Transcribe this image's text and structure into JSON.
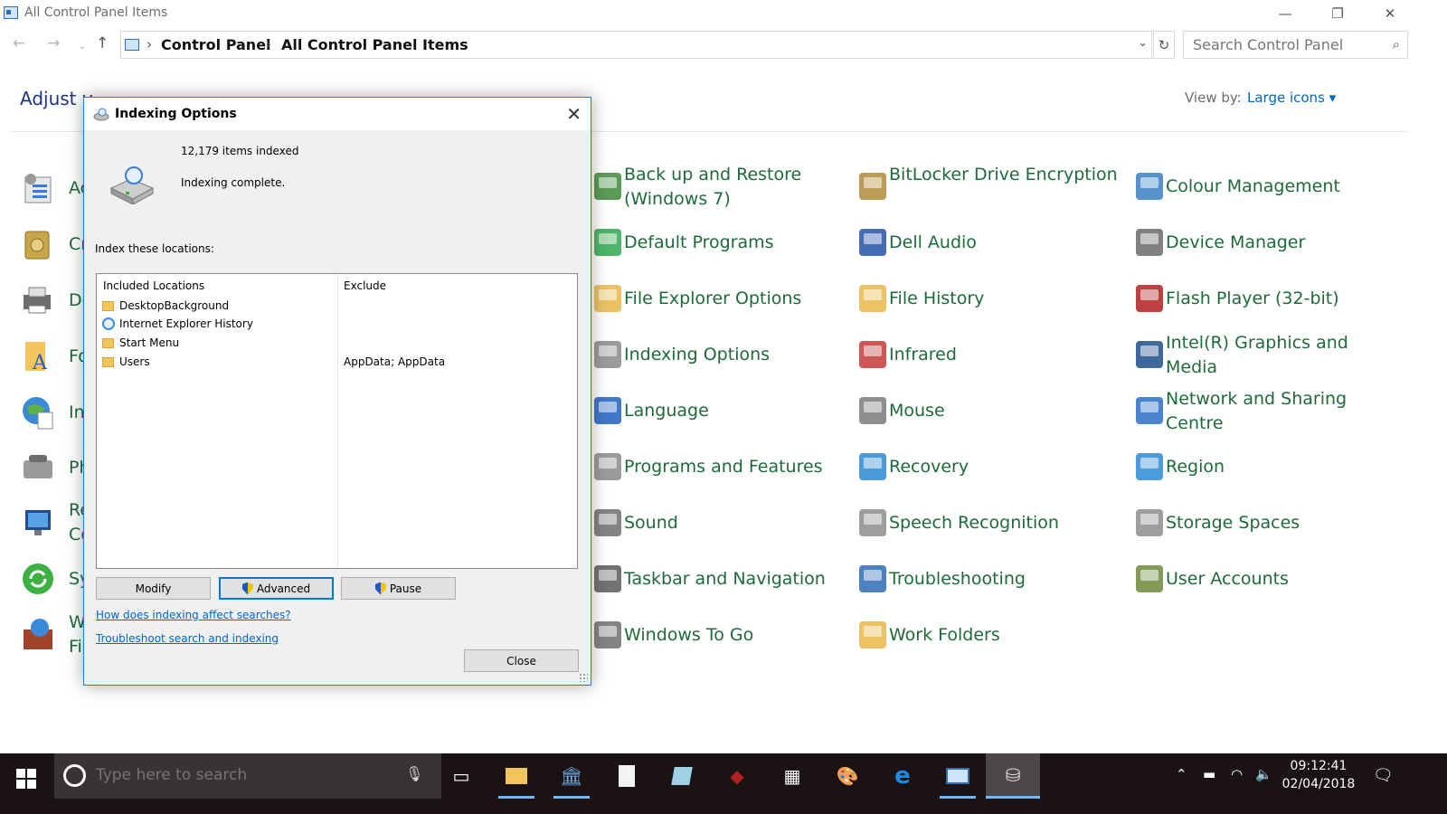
{
  "window": {
    "title": "All Control Panel Items",
    "minimize_glyph": "—",
    "restore_glyph": "❐",
    "close_glyph": "✕"
  },
  "address": {
    "crumbs": [
      "Control Panel",
      "All Control Panel Items"
    ],
    "search_placeholder": "Search Control Panel"
  },
  "header": {
    "adjust_text": "Adjust y",
    "view_by_label": "View by:",
    "view_by_value": "Large icons ▾"
  },
  "left_column_fragments": [
    "Ac",
    "Cr",
    "De",
    "Fo",
    "In",
    "Ph",
    "Re",
    "Co",
    "Sy",
    "W",
    "Fi"
  ],
  "items": [
    {
      "label": "Back up and Restore (Windows 7)",
      "icon": "backup-icon",
      "color": "#3f8a3a"
    },
    {
      "label": "BitLocker Drive Encryption",
      "icon": "bitlocker-key-icon",
      "color": "#b08b3a"
    },
    {
      "label": "Colour Management",
      "icon": "colour-management-icon",
      "color": "#3b7fc4"
    },
    {
      "label": "Default Programs",
      "icon": "default-programs-icon",
      "color": "#2fa84f"
    },
    {
      "label": "Dell Audio",
      "icon": "dell-audio-icon",
      "color": "#2453a8"
    },
    {
      "label": "Device Manager",
      "icon": "device-manager-icon",
      "color": "#6b6b6b"
    },
    {
      "label": "File Explorer Options",
      "icon": "file-explorer-options-icon",
      "color": "#e8b84a"
    },
    {
      "label": "File History",
      "icon": "file-history-icon",
      "color": "#e8b84a"
    },
    {
      "label": "Flash Player (32-bit)",
      "icon": "flash-player-icon",
      "color": "#b32020"
    },
    {
      "label": "Indexing Options",
      "icon": "indexing-options-icon",
      "color": "#8a8a8a"
    },
    {
      "label": "Infrared",
      "icon": "infrared-icon",
      "color": "#c43a3a"
    },
    {
      "label": "Intel(R) Graphics and Media",
      "icon": "intel-graphics-icon",
      "color": "#1d4f8a"
    },
    {
      "label": "Language",
      "icon": "language-icon",
      "color": "#2060c0"
    },
    {
      "label": "Mouse",
      "icon": "mouse-icon",
      "color": "#7a7a7a"
    },
    {
      "label": "Network and Sharing Centre",
      "icon": "network-sharing-icon",
      "color": "#2b6dc9"
    },
    {
      "label": "Programs and Features",
      "icon": "programs-features-icon",
      "color": "#8a8a8a"
    },
    {
      "label": "Recovery",
      "icon": "recovery-icon",
      "color": "#2a8ad0"
    },
    {
      "label": "Region",
      "icon": "region-globe-icon",
      "color": "#2f8ad6"
    },
    {
      "label": "Sound",
      "icon": "sound-icon",
      "color": "#6f6f6f"
    },
    {
      "label": "Speech Recognition",
      "icon": "microphone-icon",
      "color": "#8d8d8d"
    },
    {
      "label": "Storage Spaces",
      "icon": "storage-spaces-icon",
      "color": "#8d8d8d"
    },
    {
      "label": "Taskbar and Navigation",
      "icon": "taskbar-navigation-icon",
      "color": "#5a5a5a"
    },
    {
      "label": "Troubleshooting",
      "icon": "troubleshooting-icon",
      "color": "#2e6bb5"
    },
    {
      "label": "User Accounts",
      "icon": "user-accounts-icon",
      "color": "#6c8a3c"
    },
    {
      "label": "Windows To Go",
      "icon": "windows-to-go-icon",
      "color": "#6f6f6f"
    },
    {
      "label": "Work Folders",
      "icon": "work-folders-icon",
      "color": "#e8b84a"
    }
  ],
  "dialog": {
    "title": "Indexing Options",
    "items_indexed": "12,179 items indexed",
    "status": "Indexing complete.",
    "index_locations_label": "Index these locations:",
    "col_included": "Included Locations",
    "col_exclude": "Exclude",
    "locations": [
      {
        "name": "DesktopBackground",
        "exclude": "",
        "icon": "folder-icon"
      },
      {
        "name": "Internet Explorer History",
        "exclude": "",
        "icon": "internet-explorer-icon"
      },
      {
        "name": "Start Menu",
        "exclude": "",
        "icon": "folder-icon"
      },
      {
        "name": "Users",
        "exclude": "AppData; AppData",
        "icon": "folder-icon"
      }
    ],
    "modify_label": "Modify",
    "advanced_label": "Advanced",
    "pause_label": "Pause",
    "link_affect": "How does indexing affect searches?",
    "link_troubleshoot": "Troubleshoot search and indexing",
    "close_label": "Close"
  },
  "taskbar": {
    "search_placeholder": "Type here to search",
    "time": "09:12:41",
    "date": "02/04/2018"
  }
}
